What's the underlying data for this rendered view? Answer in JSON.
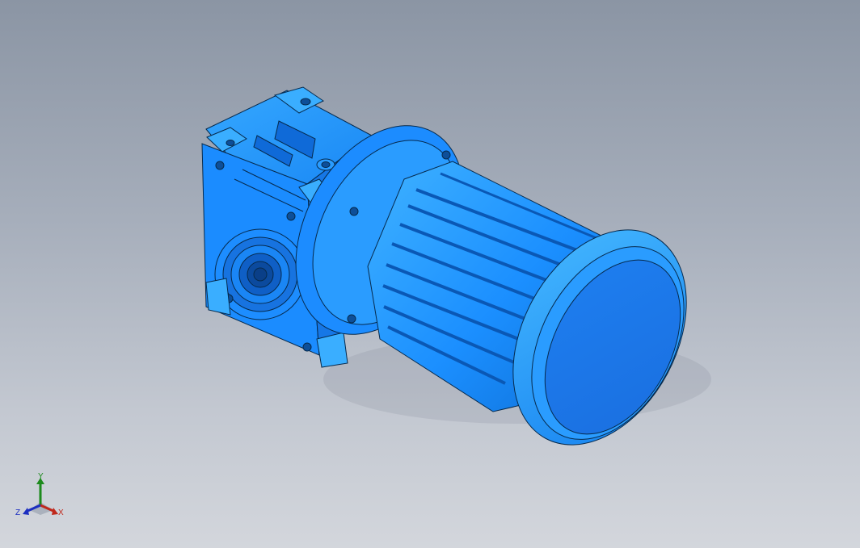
{
  "viewport": {
    "background_top": "#8b95a4",
    "background_bottom": "#d3d6dc"
  },
  "model": {
    "part_color": "#1b8fff",
    "part_highlight": "#3fb2ff",
    "part_shadow": "#0a5fbf",
    "edge_color": "#062a4d",
    "description_icon": "gear-motor-model"
  },
  "triad": {
    "x_label": "X",
    "y_label": "Y",
    "z_label": "Z",
    "x_color": "#c0281c",
    "y_color": "#1d8a1d",
    "z_color": "#1c2ec0"
  }
}
